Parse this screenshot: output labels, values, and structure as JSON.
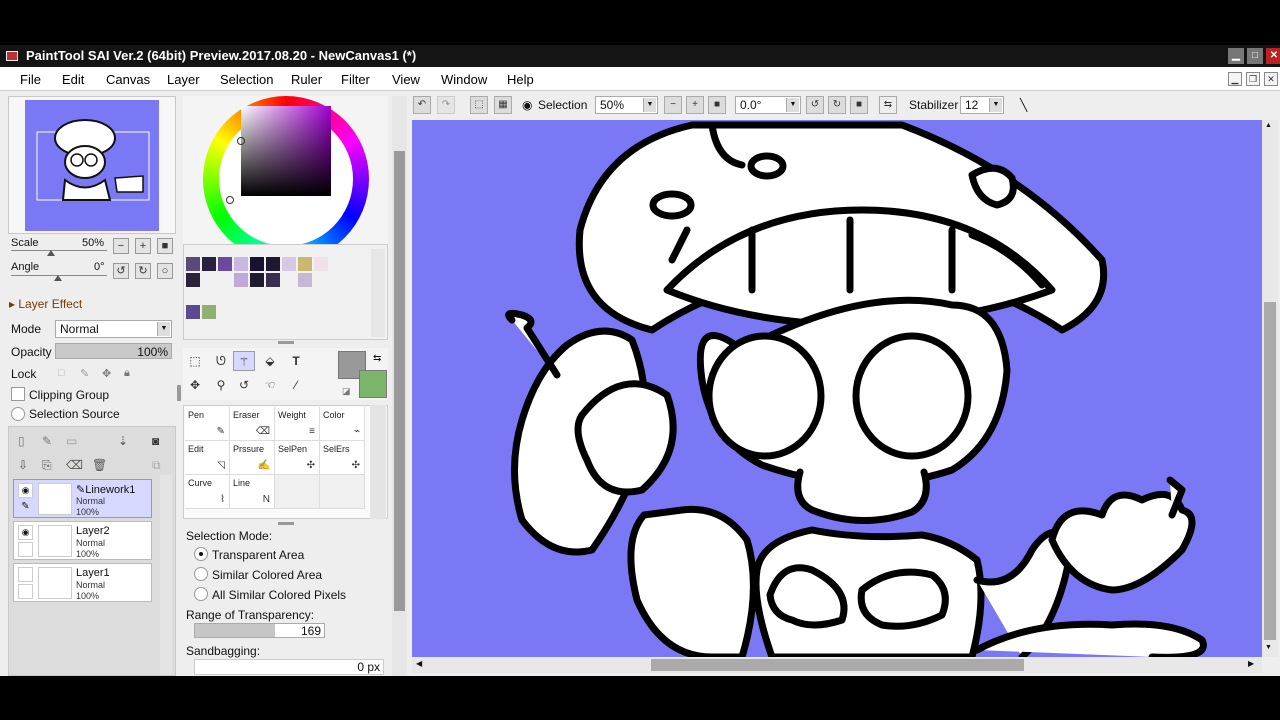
{
  "window": {
    "title": "PaintTool SAI Ver.2 (64bit) Preview.2017.08.20 - NewCanvas1 (*)"
  },
  "menu": [
    "File",
    "Edit",
    "Canvas",
    "Layer",
    "Selection",
    "Ruler",
    "Filter",
    "View",
    "Window",
    "Help"
  ],
  "navigator": {
    "scale_label": "Scale",
    "scale_value": "50%",
    "angle_label": "Angle",
    "angle_value": "0°"
  },
  "layer_effect": {
    "title": "Layer Effect",
    "mode_label": "Mode",
    "mode_value": "Normal",
    "opacity_label": "Opacity",
    "opacity_value": "100%",
    "lock_label": "Lock",
    "clipping_label": "Clipping Group",
    "selection_source_label": "Selection Source"
  },
  "layers": [
    {
      "name": "Linework1",
      "mode": "Normal",
      "opacity": "100%"
    },
    {
      "name": "Layer2",
      "mode": "Normal",
      "opacity": "100%"
    },
    {
      "name": "Layer1",
      "mode": "Normal",
      "opacity": "100%"
    }
  ],
  "swatches": [
    "#5a4a7a",
    "#2a2040",
    "#6a4aa0",
    "#c8b8e0",
    "#1a1030",
    "#201830",
    "#d8c8e8",
    "#c8b870",
    "#f0e0e8",
    "#2a2238",
    "#c0a8d8",
    "#201a2e",
    "#3a2e50",
    "#c8b8d8",
    "#5a4a90",
    "#90b070"
  ],
  "colors": {
    "foreground": "#999999",
    "background": "#7db56a",
    "canvas_bg": "#7b78f5",
    "accent": "#d6d8ff"
  },
  "brushes": [
    {
      "label": "Pen",
      "icon": "pen-icon"
    },
    {
      "label": "Eraser",
      "icon": "eraser-icon"
    },
    {
      "label": "Weight",
      "icon": "weight-icon"
    },
    {
      "label": "Color",
      "icon": "color-brush-icon"
    },
    {
      "label": "Edit",
      "icon": "edit-icon"
    },
    {
      "label": "Prssure",
      "icon": "pressure-icon"
    },
    {
      "label": "SelPen",
      "icon": "selpen-icon"
    },
    {
      "label": "SelErs",
      "icon": "selers-icon"
    },
    {
      "label": "Curve",
      "icon": "curve-icon"
    },
    {
      "label": "Line",
      "icon": "line-icon"
    }
  ],
  "tool_options": {
    "selection_mode_label": "Selection Mode:",
    "modes": [
      "Transparent Area",
      "Similar Colored Area",
      "All Similar Colored Pixels"
    ],
    "range_label": "Range of Transparency:",
    "range_value": "169",
    "range_fraction": 0.62,
    "sandbagging_label": "Sandbagging:",
    "sandbagging_value": "0 px"
  },
  "toolbar": {
    "selection_label": "Selection",
    "zoom_value": "50%",
    "rotation_value": "0.0°",
    "stabilizer_label": "Stabilizer",
    "stabilizer_value": "12"
  }
}
